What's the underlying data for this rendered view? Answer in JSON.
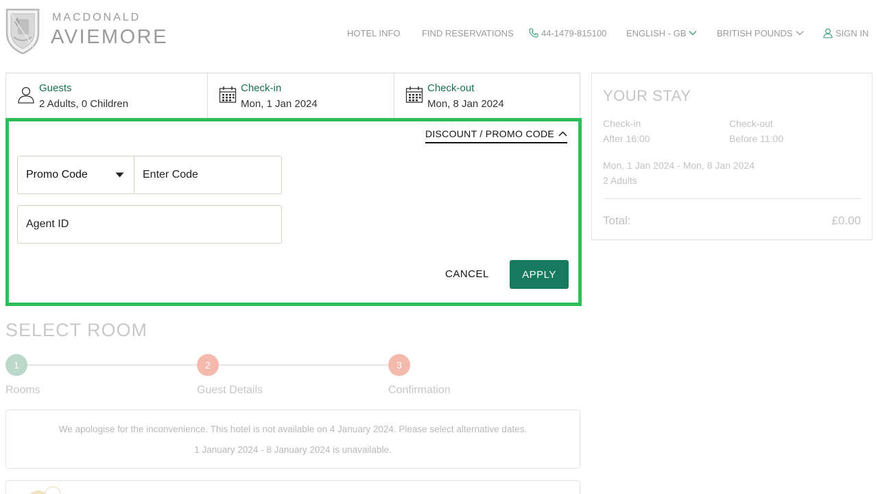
{
  "header": {
    "brand_small": "MACDONALD",
    "brand_big": "AVIEMORE",
    "nav": {
      "hotel_info": "HOTEL INFO",
      "find_reservations": "FIND RESERVATIONS",
      "phone": "44-1479-815100",
      "language": "ENGLISH - GB",
      "currency": "BRITISH POUNDS",
      "sign_in": "SIGN IN"
    }
  },
  "booking_bar": {
    "guests_label": "Guests",
    "guests_value": "2 Adults, 0 Children",
    "checkin_label": "Check-in",
    "checkin_value": "Mon, 1 Jan 2024",
    "checkout_label": "Check-out",
    "checkout_value": "Mon, 8 Jan 2024"
  },
  "promo": {
    "toggle_label": "DISCOUNT / PROMO CODE",
    "code_type": "Promo Code",
    "code_placeholder": "Enter Code",
    "agent_placeholder": "Agent ID",
    "cancel_label": "CANCEL",
    "apply_label": "APPLY"
  },
  "stay": {
    "title": "YOUR STAY",
    "checkin_label": "Check-in",
    "checkin_time": "After 16:00",
    "checkout_label": "Check-out",
    "checkout_time": "Before 11:00",
    "dates": "Mon, 1 Jan 2024 - Mon, 8 Jan 2024",
    "guests": "2 Adults",
    "total_label": "Total:",
    "total_value": "£0.00"
  },
  "select_room": {
    "title": "SELECT ROOM",
    "steps": [
      {
        "number": "1",
        "label": "Rooms"
      },
      {
        "number": "2",
        "label": "Guest Details"
      },
      {
        "number": "3",
        "label": "Confirmation"
      }
    ],
    "notice_line1": "We apologise for the inconvenience. This hotel is not available on 4 January 2024. Please select alternative dates.",
    "notice_line2": "1 January 2024 - 8 January 2024 is unavailable."
  },
  "colors": {
    "accent_green": "#177a5f",
    "label_green": "#1a6e55",
    "highlight": "#2ebd59",
    "step1": "#bcd8cb",
    "step_other": "#f3b9ad"
  }
}
